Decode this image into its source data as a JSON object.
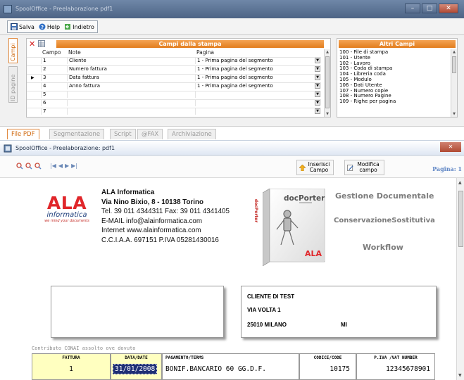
{
  "window": {
    "title": "SpoolOffice - Preelaborazione pdf1"
  },
  "toolbar": {
    "save": "Salva",
    "help": "Help",
    "back": "Indietro"
  },
  "side_tabs": {
    "campi": "Campi",
    "id_pagine": "ID pagine"
  },
  "campi_grid": {
    "header": "Campi dalla stampa",
    "columns": {
      "campo": "Campo",
      "note": "Note",
      "pagina": "Pagina"
    },
    "rows": [
      {
        "campo": "1",
        "note": "Cliente",
        "pagina": "1 - Prima pagina del segmento"
      },
      {
        "campo": "2",
        "note": "Numero fattura",
        "pagina": "1 - Prima pagina del segmento"
      },
      {
        "campo": "3",
        "note": "Data fattura",
        "pagina": "1 - Prima pagina del segmento"
      },
      {
        "campo": "4",
        "note": "Anno fattura",
        "pagina": "1 - Prima pagina del segmento"
      },
      {
        "campo": "5",
        "note": "",
        "pagina": ""
      },
      {
        "campo": "6",
        "note": "",
        "pagina": ""
      },
      {
        "campo": "7",
        "note": "",
        "pagina": ""
      }
    ]
  },
  "altri_campi": {
    "header": "Altri Campi",
    "items": [
      "100 - File di stampa",
      "101 - Utente",
      "102 - Lavoro",
      "103 - Coda di stampa",
      "104 - Libreria coda",
      "105 - Modulo",
      "106 - Dati Utente",
      "107 - Numero copie",
      "108 - Numero Pagine",
      "109 - Righe per pagina"
    ]
  },
  "bottom_tabs": [
    "File PDF",
    "Segmentazione",
    "Script",
    "@FAX",
    "Archiviazione"
  ],
  "inner_window": {
    "title": "SpoolOffice - Preelaborazione: pdf1"
  },
  "preview_toolbar": {
    "inserisci": [
      "Inserisci",
      "Campo"
    ],
    "modifica": [
      "Modifica",
      "campo"
    ],
    "pagina": "Pagina: 1"
  },
  "document": {
    "logo": {
      "name": "ALA",
      "sub": "informatica",
      "tagline": "we mind your documents"
    },
    "company": [
      "ALA Informatica",
      "Via Nino Bixio, 8 - 10138 Torino",
      "Tel. 39 011 4344311  Fax: 39 011 4341405",
      "E-MAIL info@alainformatica.com",
      "Internet www.alainformatica.com",
      "C.C.I.A.A. 697151  P.IVA 05281430016"
    ],
    "product": {
      "name": "docPorter",
      "brand": "ALA",
      "box_side": "docPorter"
    },
    "product_lines": [
      "Gestione Documentale",
      "ConservazioneSostitutiva",
      "Workflow"
    ],
    "client": {
      "name": "CLIENTE DI TEST",
      "street": "VIA VOLTA 1",
      "city": "25010 MILANO",
      "prov": "MI"
    },
    "contrib": "Contributo CONAI assolto ove dovuto",
    "table": {
      "fattura_h": "FATTURA",
      "fattura_v": "1",
      "data_h": "DATA/DATE",
      "data_v": "31/01/2008",
      "pag_h": "PAGAMENTO/TERMS",
      "pag_v": "BONIF.BANCARIO 60 GG.D.F.",
      "cod_h": "CODICE/CODE",
      "cod_v": "10175",
      "piva_h": "P.IVA /VAT NUMBER",
      "piva_v": "12345678901"
    }
  }
}
